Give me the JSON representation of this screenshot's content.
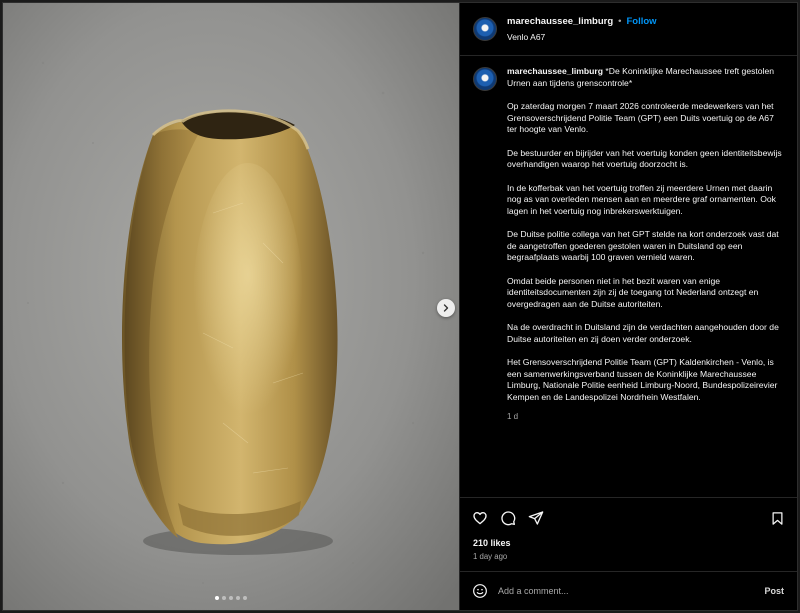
{
  "header": {
    "username": "marechaussee_limburg",
    "separator": "•",
    "follow_label": "Follow",
    "location": "Venlo A67"
  },
  "caption": {
    "username": "marechaussee_limburg",
    "title": "*De Koninklijke Marechaussee treft gestolen Urnen aan tijdens grenscontrole*",
    "paragraphs": [
      "Op zaterdag morgen 7 maart 2026 controleerde medewerkers van het Grensoverschrijdend Politie Team (GPT) een Duits voertuig op de A67 ter hoogte van Venlo.",
      "De bestuurder en bijrijder van het voertuig konden geen identiteitsbewijs overhandigen waarop het voertuig doorzocht is.",
      "In de kofferbak van het voertuig troffen zij meerdere Urnen met daarin nog as van overleden mensen aan en meerdere graf ornamenten. Ook lagen in het voertuig nog inbrekerswerktuigen.",
      "De Duitse politie collega van het GPT stelde na kort onderzoek vast dat de aangetroffen goederen gestolen waren in Duitsland op een begraafplaats waarbij 100 graven vernield waren.",
      "Omdat beide personen niet in het bezit waren van enige identiteitsdocumenten zijn zij de toegang tot Nederland ontzegt en overgedragen aan de Duitse autoriteiten.",
      "Na de overdracht in Duitsland zijn de verdachten aangehouden door de Duitse autoriteiten en zij doen verder onderzoek.",
      "Het Grensoverschrijdend Politie Team (GPT) Kaldenkirchen - Venlo, is een samenwerkingsverband tussen de Koninklijke Marechaussee Limburg, Nationale Politie eenheid Limburg-Noord, Bundespolizeirevier Kempen en de Landespolizei Nordrhein Westfalen."
    ],
    "relative_time": "1 d"
  },
  "actions": {
    "like_icon": "heart-icon",
    "comment_icon": "comment-icon",
    "share_icon": "send-icon",
    "save_icon": "bookmark-icon"
  },
  "likes": "210 likes",
  "posted_ago": "1 day ago",
  "comment": {
    "placeholder": "Add a comment...",
    "post_label": "Post",
    "emoji_icon": "emoji-icon"
  },
  "carousel": {
    "total_slides": 5,
    "active_slide": 1
  },
  "colors": {
    "accent": "#0095f6",
    "background": "#000000",
    "text": "#f5f5f5",
    "muted": "#a8a8a8"
  }
}
